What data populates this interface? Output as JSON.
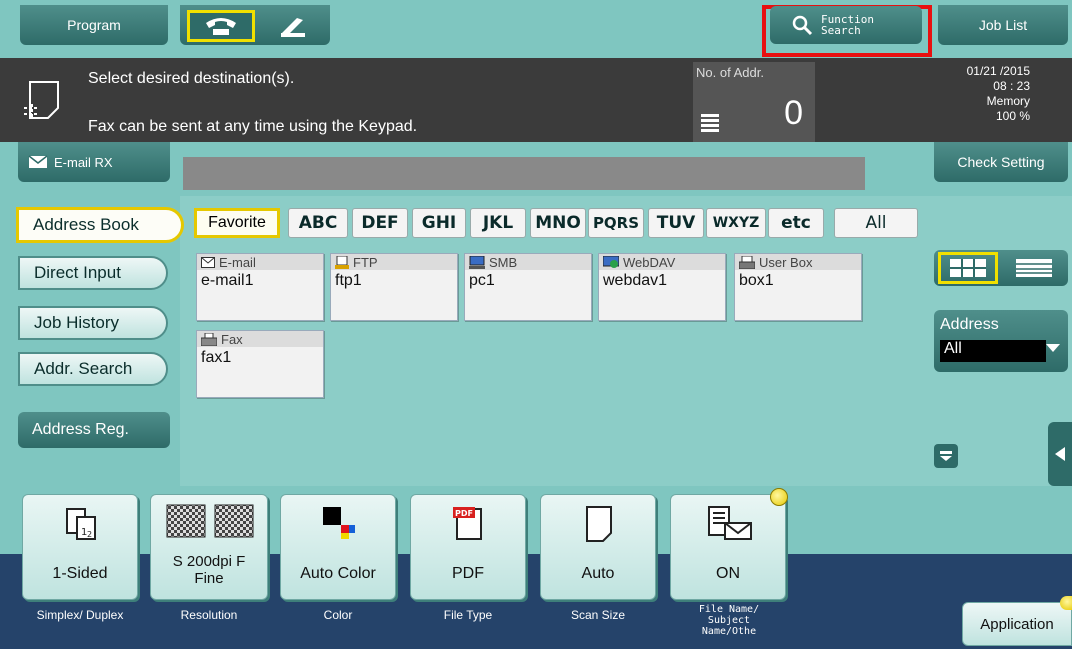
{
  "topbar": {
    "program_label": "Program",
    "function_search_label": "Function Search",
    "job_list_label": "Job List"
  },
  "message": {
    "line1": "Select desired destination(s).",
    "line2": "Fax can be sent at any time using the Keypad.",
    "addr_count_label": "No. of Addr.",
    "addr_count": "0",
    "date": "01/21 /2015",
    "time": "08 : 23",
    "memory_label": "Memory",
    "memory_value": "100 %"
  },
  "emailrx_label": "E-mail RX",
  "check_setting_label": "Check Setting",
  "left_nav": [
    {
      "label": "Address Book"
    },
    {
      "label": "Direct Input"
    },
    {
      "label": "Job History"
    },
    {
      "label": "Addr. Search"
    }
  ],
  "address_reg_label": "Address Reg.",
  "index_tabs": {
    "favorite": "Favorite",
    "letters": [
      "ABC",
      "DEF",
      "GHI",
      "JKL",
      "MNO",
      "PQRS",
      "TUV",
      "WXYZ",
      "etc"
    ],
    "all": "All"
  },
  "destinations": [
    {
      "type": "E-mail",
      "name": "e-mail1",
      "icon": "envelope-icon"
    },
    {
      "type": "FTP",
      "name": "ftp1",
      "icon": "ftp-icon"
    },
    {
      "type": "SMB",
      "name": "pc1",
      "icon": "computer-icon"
    },
    {
      "type": "WebDAV",
      "name": "webdav1",
      "icon": "webdav-icon"
    },
    {
      "type": "User Box",
      "name": "box1",
      "icon": "user-box-icon"
    },
    {
      "type": "Fax",
      "name": "fax1",
      "icon": "fax-icon"
    }
  ],
  "address_filter": {
    "label": "Address",
    "value": "All"
  },
  "functions": [
    {
      "label": "1-Sided",
      "caption": "Simplex/ Duplex",
      "icon": "simplex-icon"
    },
    {
      "label": "S 200dpi F Fine",
      "caption": "Resolution",
      "icon": "resolution-icon"
    },
    {
      "label": "Auto Color",
      "caption": "Color",
      "icon": "color-icon"
    },
    {
      "label": "PDF",
      "caption": "File Type",
      "icon": "pdf-icon"
    },
    {
      "label": "Auto",
      "caption": "Scan Size",
      "icon": "page-icon"
    },
    {
      "label": "ON",
      "caption": "File Name/ Subject Name/Othe",
      "icon": "file-name-icon"
    }
  ],
  "application_label": "Application",
  "colors": {
    "highlight": "#e03030",
    "selected": "#e5c800",
    "teal": "#7fc6c0",
    "dark": "#3b3b3b"
  }
}
